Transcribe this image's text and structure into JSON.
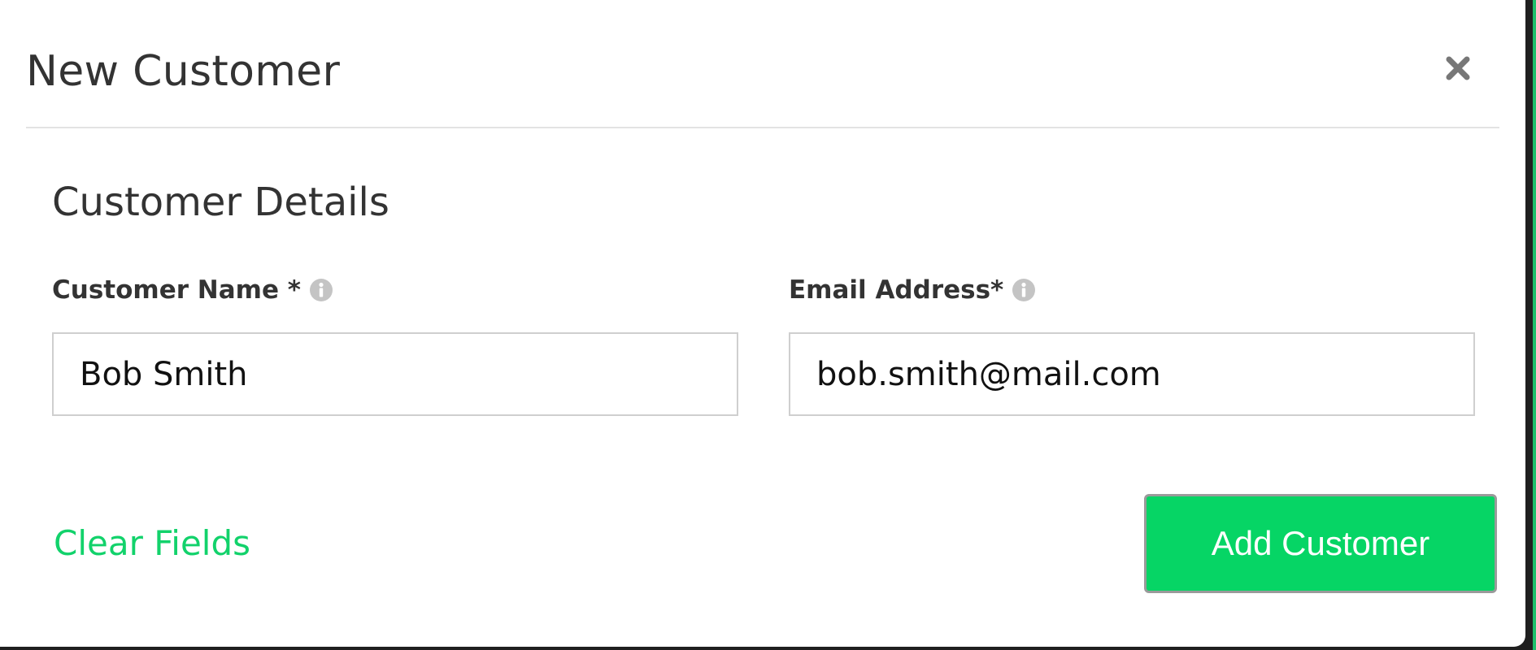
{
  "modal": {
    "title": "New Customer"
  },
  "section": {
    "title": "Customer Details"
  },
  "fields": {
    "name": {
      "label": "Customer Name *",
      "value": "Bob Smith",
      "icon": "info-icon"
    },
    "email": {
      "label": "Email Address*",
      "value": "bob.smith@mail.com",
      "icon": "info-icon"
    }
  },
  "footer": {
    "clear_label": "Clear Fields",
    "submit_label": "Add Customer"
  },
  "colors": {
    "accent": "#06d565",
    "link": "#12d26b",
    "text": "#333333"
  }
}
